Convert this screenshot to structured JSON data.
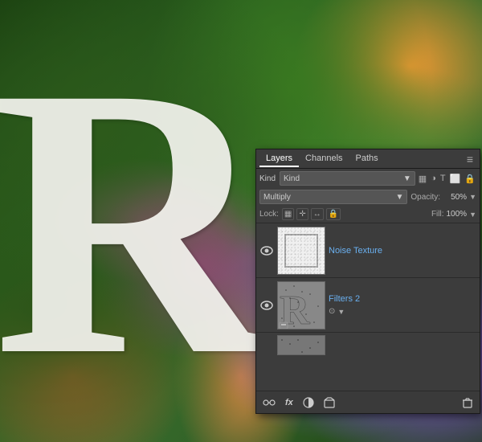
{
  "background": {
    "alt": "Flowers background with letter R"
  },
  "layers_panel": {
    "tabs": [
      {
        "id": "layers",
        "label": "Layers",
        "active": true
      },
      {
        "id": "channels",
        "label": "Channels",
        "active": false
      },
      {
        "id": "paths",
        "label": "Paths",
        "active": false
      }
    ],
    "menu_icon": "≡",
    "filter_label": "Kind",
    "filter_dropdown_label": "Kind",
    "filter_icons": [
      "▦",
      "◑",
      "T",
      "□",
      "🔒"
    ],
    "blend_mode": "Multiply",
    "opacity_label": "Opacity:",
    "opacity_value": "50%",
    "fill_label": "Fill:",
    "fill_value": "100%",
    "lock_label": "Lock:",
    "lock_icons": [
      "▦",
      "+",
      "↔",
      "□",
      "🔒"
    ],
    "layers": [
      {
        "id": 1,
        "name": "Noise Texture",
        "visible": true,
        "selected": false,
        "thumb_type": "noise"
      },
      {
        "id": 2,
        "name": "Filters 2",
        "visible": true,
        "selected": false,
        "thumb_type": "filters",
        "has_fx": true,
        "has_mask": true
      },
      {
        "id": 3,
        "name": "",
        "visible": false,
        "selected": false,
        "thumb_type": "partial"
      }
    ],
    "toolbar": {
      "link_icon": "🔗",
      "fx_icon": "fx",
      "adjustment_icon": "◑",
      "folder_icon": "📁",
      "trash_icon": "🗑"
    }
  }
}
